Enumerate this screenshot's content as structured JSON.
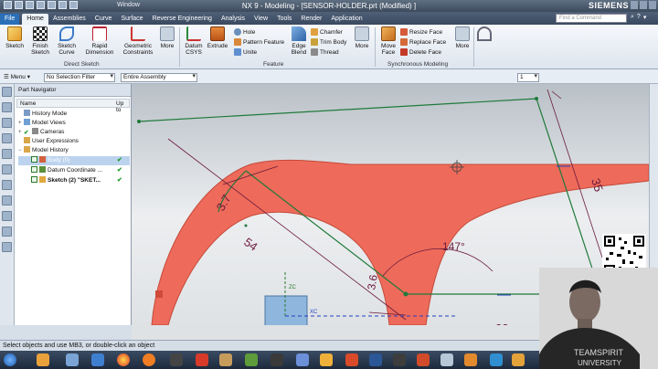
{
  "window": {
    "title": "NX 9 - Modeling - [SENSOR-HOLDER.prt (Modified) ]",
    "window_menu": "Window",
    "brand": "SIEMENS"
  },
  "menubar": {
    "items": [
      "File",
      "Home",
      "Assemblies",
      "Curve",
      "Surface",
      "Reverse Engineering",
      "Analysis",
      "View",
      "Tools",
      "Render",
      "Application"
    ],
    "active": "Home",
    "find_placeholder": "Find a Command"
  },
  "ribbon": {
    "direct_sketch": {
      "label": "Direct Sketch",
      "buttons": [
        "Sketch",
        "Finish Sketch",
        "Sketch Curve",
        "Rapid Dimension",
        "Geometric Constraints",
        "More"
      ]
    },
    "feature": {
      "label": "Feature",
      "buttons": [
        "Datum CSYS",
        "Extrude",
        "Edge Blend",
        "More"
      ],
      "small": [
        "Hole",
        "Pattern Feature",
        "Unite",
        "Chamfer",
        "Trim Body",
        "Thread"
      ]
    },
    "synchronous": {
      "label": "Synchronous Modeling",
      "buttons": [
        "Move Face",
        "More"
      ],
      "small": [
        "Resize Face",
        "Replace Face",
        "Delete Face"
      ]
    }
  },
  "selection_bar": {
    "menu": "Menu",
    "filter": "No Selection Filter",
    "scope": "Entire Assembly",
    "count": "1"
  },
  "navigator": {
    "title": "Part Navigator",
    "col_name": "Name",
    "col_upto": "Up to",
    "rows": [
      {
        "label": "History Mode",
        "indent": 0,
        "check": ""
      },
      {
        "label": "Model Views",
        "indent": 0,
        "check": ""
      },
      {
        "label": "Cameras",
        "indent": 0,
        "check": ""
      },
      {
        "label": "User Expressions",
        "indent": 0,
        "check": ""
      },
      {
        "label": "Model History",
        "indent": 0,
        "check": ""
      },
      {
        "label": "Body (0)",
        "indent": 1,
        "check": "✔"
      },
      {
        "label": "Datum Coordinate ...",
        "indent": 1,
        "check": "✔"
      },
      {
        "label": "Sketch (2) \"SKET...",
        "indent": 1,
        "check": "✔"
      }
    ]
  },
  "graphics": {
    "dims": [
      "3.7",
      "54",
      "35",
      "147°",
      "3.6",
      "22"
    ],
    "axis_labels": [
      "ZC",
      "XC"
    ],
    "colors": {
      "body": "#ee6a5a",
      "sketch": "#1f7a3a",
      "dim": "#6b1b3d"
    }
  },
  "status": {
    "text": "Select objects and use MB3, or double-click an object"
  },
  "webcam": {
    "shirt_text_1": "TEAMSPIRIT",
    "shirt_text_2": "UNIVERSITY"
  }
}
